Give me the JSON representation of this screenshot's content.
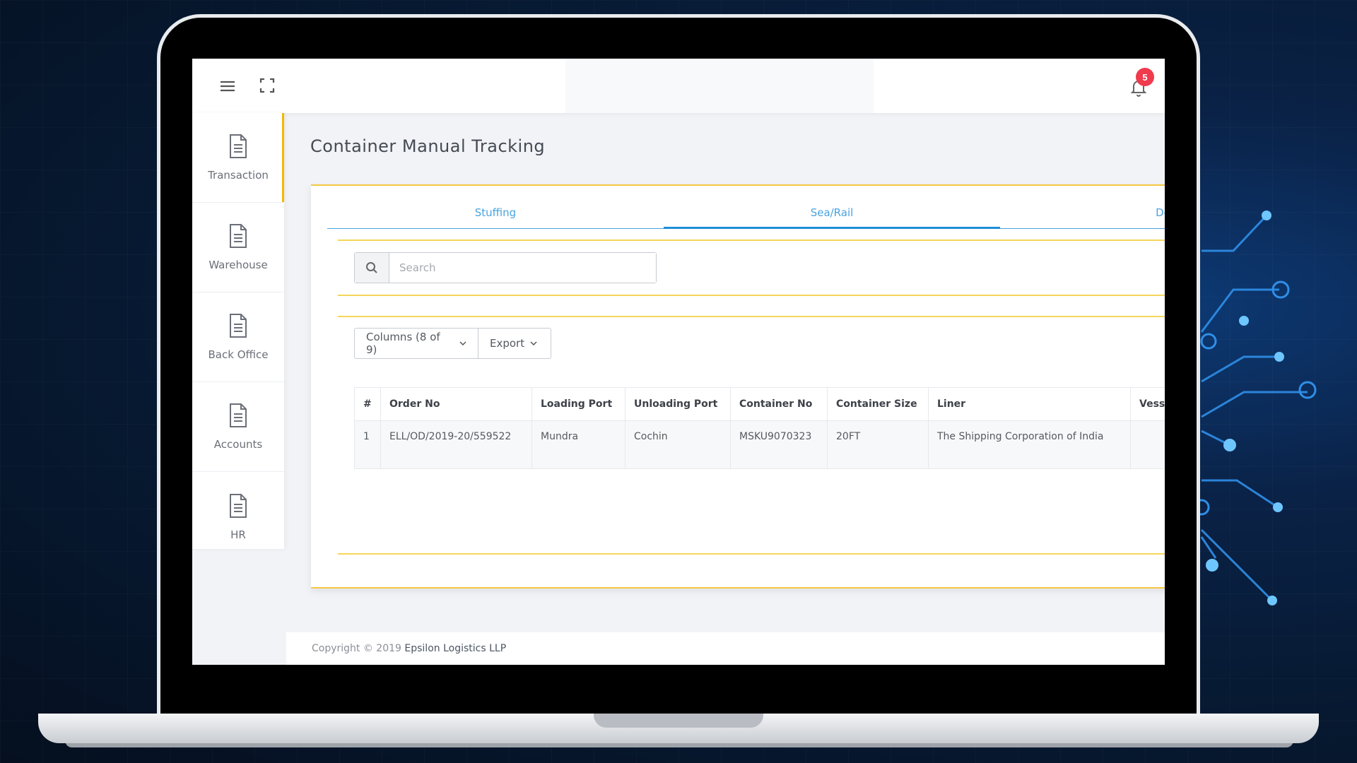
{
  "topbar": {
    "menu_icon": "hamburger-menu-icon",
    "fullscreen_icon": "fullscreen-icon",
    "notification_icon": "bell-icon",
    "notification_count": "5"
  },
  "sidebar": {
    "items": [
      {
        "label": "Transaction",
        "icon": "document-icon",
        "active": true
      },
      {
        "label": "Warehouse",
        "icon": "document-icon",
        "active": false
      },
      {
        "label": "Back Office",
        "icon": "document-icon",
        "active": false
      },
      {
        "label": "Accounts",
        "icon": "document-icon",
        "active": false
      },
      {
        "label": "HR",
        "icon": "document-icon",
        "active": false
      }
    ]
  },
  "main": {
    "title": "Container Manual Tracking",
    "tabs": [
      {
        "label": "Stuffing",
        "active": false
      },
      {
        "label": "Sea/Rail",
        "active": true
      },
      {
        "label": "De-S",
        "active": false
      }
    ],
    "search": {
      "placeholder": "Search",
      "value": ""
    },
    "toolbar": {
      "columns_label": "Columns (8 of 9)",
      "export_label": "Export"
    },
    "table": {
      "columns": [
        "#",
        "Order No",
        "Loading Port",
        "Unloading Port",
        "Container No",
        "Container Size",
        "Liner",
        "Vess"
      ],
      "rows": [
        [
          "1",
          "ELL/OD/2019-20/559522",
          "Mundra",
          "Cochin",
          "MSKU9070323",
          "20FT",
          "The Shipping Corporation of India",
          ""
        ]
      ]
    }
  },
  "footer": {
    "copyright": "Copyright © 2019",
    "company": "Epsilon Logistics LLP"
  },
  "colors": {
    "accent_yellow": "#f5c842",
    "tab_blue": "#4aa3df",
    "badge_red": "#ef3b4d"
  }
}
